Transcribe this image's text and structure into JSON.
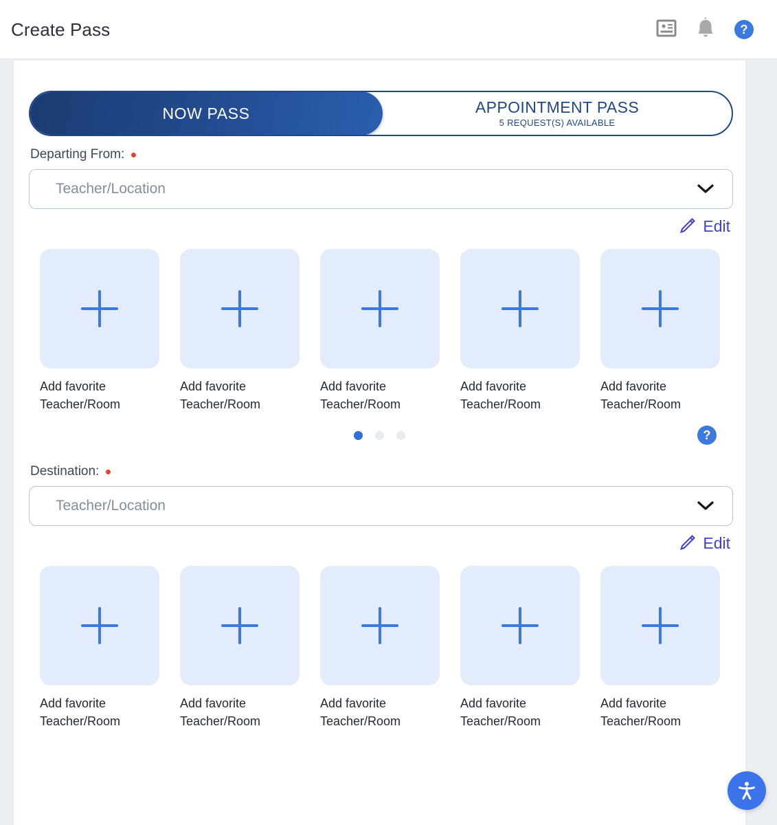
{
  "appbar": {
    "title": "Create Pass",
    "icons": {
      "id_card": "id-card-icon",
      "bell": "bell-icon",
      "help": "?"
    }
  },
  "pass_toggle": {
    "now_pass": {
      "label": "NOW PASS",
      "active": true
    },
    "appointment_pass": {
      "label": "APPOINTMENT PASS",
      "sublabel": "5 REQUEST(S) AVAILABLE",
      "active": false
    }
  },
  "departing": {
    "label": "Departing From:",
    "required": true,
    "select_placeholder": "Teacher/Location",
    "edit_label": "Edit",
    "favorites": [
      {
        "caption": "Add favorite Teacher/Room",
        "icon": "plus-icon"
      },
      {
        "caption": "Add favorite Teacher/Room",
        "icon": "plus-icon"
      },
      {
        "caption": "Add favorite Teacher/Room",
        "icon": "plus-icon"
      },
      {
        "caption": "Add favorite Teacher/Room",
        "icon": "plus-icon"
      },
      {
        "caption": "Add favorite Teacher/Room",
        "icon": "plus-icon"
      }
    ],
    "carousel": {
      "pages": 3,
      "active_page": 1
    },
    "help_label": "?"
  },
  "destination": {
    "label": "Destination:",
    "required": true,
    "select_placeholder": "Teacher/Location",
    "edit_label": "Edit",
    "favorites": [
      {
        "caption": "Add favorite Teacher/Room",
        "icon": "plus-icon"
      },
      {
        "caption": "Add favorite Teacher/Room",
        "icon": "plus-icon"
      },
      {
        "caption": "Add favorite Teacher/Room",
        "icon": "plus-icon"
      },
      {
        "caption": "Add favorite Teacher/Room",
        "icon": "plus-icon"
      },
      {
        "caption": "Add favorite Teacher/Room",
        "icon": "plus-icon"
      }
    ]
  },
  "accessibility_button": {
    "icon": "accessibility-icon"
  },
  "colors": {
    "brand_navy": "#1f4788",
    "brand_blue": "#3b78e0",
    "edit_indigo": "#3f3fd6",
    "required_red": "#e0472c",
    "tile_bg": "#e2ecfa",
    "page_bg": "#eaedf1"
  }
}
